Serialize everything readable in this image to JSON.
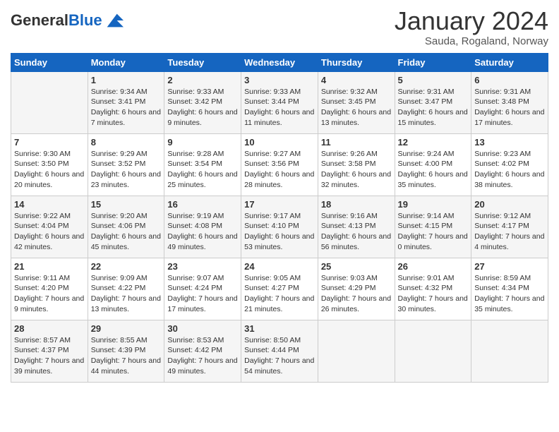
{
  "logo": {
    "general": "General",
    "blue": "Blue"
  },
  "title": "January 2024",
  "subtitle": "Sauda, Rogaland, Norway",
  "days_of_week": [
    "Sunday",
    "Monday",
    "Tuesday",
    "Wednesday",
    "Thursday",
    "Friday",
    "Saturday"
  ],
  "weeks": [
    [
      {
        "day": "",
        "sunrise": "",
        "sunset": "",
        "daylight": ""
      },
      {
        "day": "1",
        "sunrise": "Sunrise: 9:34 AM",
        "sunset": "Sunset: 3:41 PM",
        "daylight": "Daylight: 6 hours and 7 minutes."
      },
      {
        "day": "2",
        "sunrise": "Sunrise: 9:33 AM",
        "sunset": "Sunset: 3:42 PM",
        "daylight": "Daylight: 6 hours and 9 minutes."
      },
      {
        "day": "3",
        "sunrise": "Sunrise: 9:33 AM",
        "sunset": "Sunset: 3:44 PM",
        "daylight": "Daylight: 6 hours and 11 minutes."
      },
      {
        "day": "4",
        "sunrise": "Sunrise: 9:32 AM",
        "sunset": "Sunset: 3:45 PM",
        "daylight": "Daylight: 6 hours and 13 minutes."
      },
      {
        "day": "5",
        "sunrise": "Sunrise: 9:31 AM",
        "sunset": "Sunset: 3:47 PM",
        "daylight": "Daylight: 6 hours and 15 minutes."
      },
      {
        "day": "6",
        "sunrise": "Sunrise: 9:31 AM",
        "sunset": "Sunset: 3:48 PM",
        "daylight": "Daylight: 6 hours and 17 minutes."
      }
    ],
    [
      {
        "day": "7",
        "sunrise": "Sunrise: 9:30 AM",
        "sunset": "Sunset: 3:50 PM",
        "daylight": "Daylight: 6 hours and 20 minutes."
      },
      {
        "day": "8",
        "sunrise": "Sunrise: 9:29 AM",
        "sunset": "Sunset: 3:52 PM",
        "daylight": "Daylight: 6 hours and 23 minutes."
      },
      {
        "day": "9",
        "sunrise": "Sunrise: 9:28 AM",
        "sunset": "Sunset: 3:54 PM",
        "daylight": "Daylight: 6 hours and 25 minutes."
      },
      {
        "day": "10",
        "sunrise": "Sunrise: 9:27 AM",
        "sunset": "Sunset: 3:56 PM",
        "daylight": "Daylight: 6 hours and 28 minutes."
      },
      {
        "day": "11",
        "sunrise": "Sunrise: 9:26 AM",
        "sunset": "Sunset: 3:58 PM",
        "daylight": "Daylight: 6 hours and 32 minutes."
      },
      {
        "day": "12",
        "sunrise": "Sunrise: 9:24 AM",
        "sunset": "Sunset: 4:00 PM",
        "daylight": "Daylight: 6 hours and 35 minutes."
      },
      {
        "day": "13",
        "sunrise": "Sunrise: 9:23 AM",
        "sunset": "Sunset: 4:02 PM",
        "daylight": "Daylight: 6 hours and 38 minutes."
      }
    ],
    [
      {
        "day": "14",
        "sunrise": "Sunrise: 9:22 AM",
        "sunset": "Sunset: 4:04 PM",
        "daylight": "Daylight: 6 hours and 42 minutes."
      },
      {
        "day": "15",
        "sunrise": "Sunrise: 9:20 AM",
        "sunset": "Sunset: 4:06 PM",
        "daylight": "Daylight: 6 hours and 45 minutes."
      },
      {
        "day": "16",
        "sunrise": "Sunrise: 9:19 AM",
        "sunset": "Sunset: 4:08 PM",
        "daylight": "Daylight: 6 hours and 49 minutes."
      },
      {
        "day": "17",
        "sunrise": "Sunrise: 9:17 AM",
        "sunset": "Sunset: 4:10 PM",
        "daylight": "Daylight: 6 hours and 53 minutes."
      },
      {
        "day": "18",
        "sunrise": "Sunrise: 9:16 AM",
        "sunset": "Sunset: 4:13 PM",
        "daylight": "Daylight: 6 hours and 56 minutes."
      },
      {
        "day": "19",
        "sunrise": "Sunrise: 9:14 AM",
        "sunset": "Sunset: 4:15 PM",
        "daylight": "Daylight: 7 hours and 0 minutes."
      },
      {
        "day": "20",
        "sunrise": "Sunrise: 9:12 AM",
        "sunset": "Sunset: 4:17 PM",
        "daylight": "Daylight: 7 hours and 4 minutes."
      }
    ],
    [
      {
        "day": "21",
        "sunrise": "Sunrise: 9:11 AM",
        "sunset": "Sunset: 4:20 PM",
        "daylight": "Daylight: 7 hours and 9 minutes."
      },
      {
        "day": "22",
        "sunrise": "Sunrise: 9:09 AM",
        "sunset": "Sunset: 4:22 PM",
        "daylight": "Daylight: 7 hours and 13 minutes."
      },
      {
        "day": "23",
        "sunrise": "Sunrise: 9:07 AM",
        "sunset": "Sunset: 4:24 PM",
        "daylight": "Daylight: 7 hours and 17 minutes."
      },
      {
        "day": "24",
        "sunrise": "Sunrise: 9:05 AM",
        "sunset": "Sunset: 4:27 PM",
        "daylight": "Daylight: 7 hours and 21 minutes."
      },
      {
        "day": "25",
        "sunrise": "Sunrise: 9:03 AM",
        "sunset": "Sunset: 4:29 PM",
        "daylight": "Daylight: 7 hours and 26 minutes."
      },
      {
        "day": "26",
        "sunrise": "Sunrise: 9:01 AM",
        "sunset": "Sunset: 4:32 PM",
        "daylight": "Daylight: 7 hours and 30 minutes."
      },
      {
        "day": "27",
        "sunrise": "Sunrise: 8:59 AM",
        "sunset": "Sunset: 4:34 PM",
        "daylight": "Daylight: 7 hours and 35 minutes."
      }
    ],
    [
      {
        "day": "28",
        "sunrise": "Sunrise: 8:57 AM",
        "sunset": "Sunset: 4:37 PM",
        "daylight": "Daylight: 7 hours and 39 minutes."
      },
      {
        "day": "29",
        "sunrise": "Sunrise: 8:55 AM",
        "sunset": "Sunset: 4:39 PM",
        "daylight": "Daylight: 7 hours and 44 minutes."
      },
      {
        "day": "30",
        "sunrise": "Sunrise: 8:53 AM",
        "sunset": "Sunset: 4:42 PM",
        "daylight": "Daylight: 7 hours and 49 minutes."
      },
      {
        "day": "31",
        "sunrise": "Sunrise: 8:50 AM",
        "sunset": "Sunset: 4:44 PM",
        "daylight": "Daylight: 7 hours and 54 minutes."
      },
      {
        "day": "",
        "sunrise": "",
        "sunset": "",
        "daylight": ""
      },
      {
        "day": "",
        "sunrise": "",
        "sunset": "",
        "daylight": ""
      },
      {
        "day": "",
        "sunrise": "",
        "sunset": "",
        "daylight": ""
      }
    ]
  ]
}
